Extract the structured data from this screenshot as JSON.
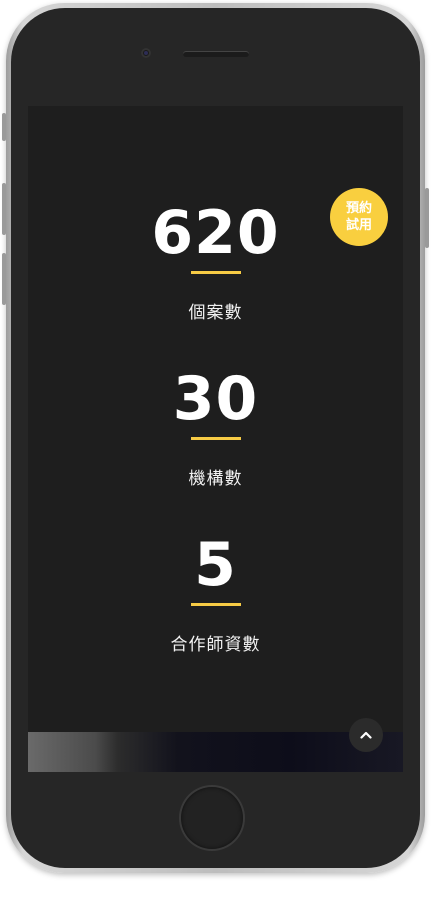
{
  "stats": [
    {
      "value": "620",
      "label": "個案數"
    },
    {
      "value": "30",
      "label": "機構數"
    },
    {
      "value": "5",
      "label": "合作師資數"
    }
  ],
  "badge": {
    "line1": "預約",
    "line2": "試用"
  },
  "scroll_top": {
    "icon": "chevron-up-icon"
  },
  "colors": {
    "accent": "#f7cb45",
    "badge": "#f9cf3f",
    "screen_background": "#1e1e1e",
    "text": "#ffffff"
  }
}
